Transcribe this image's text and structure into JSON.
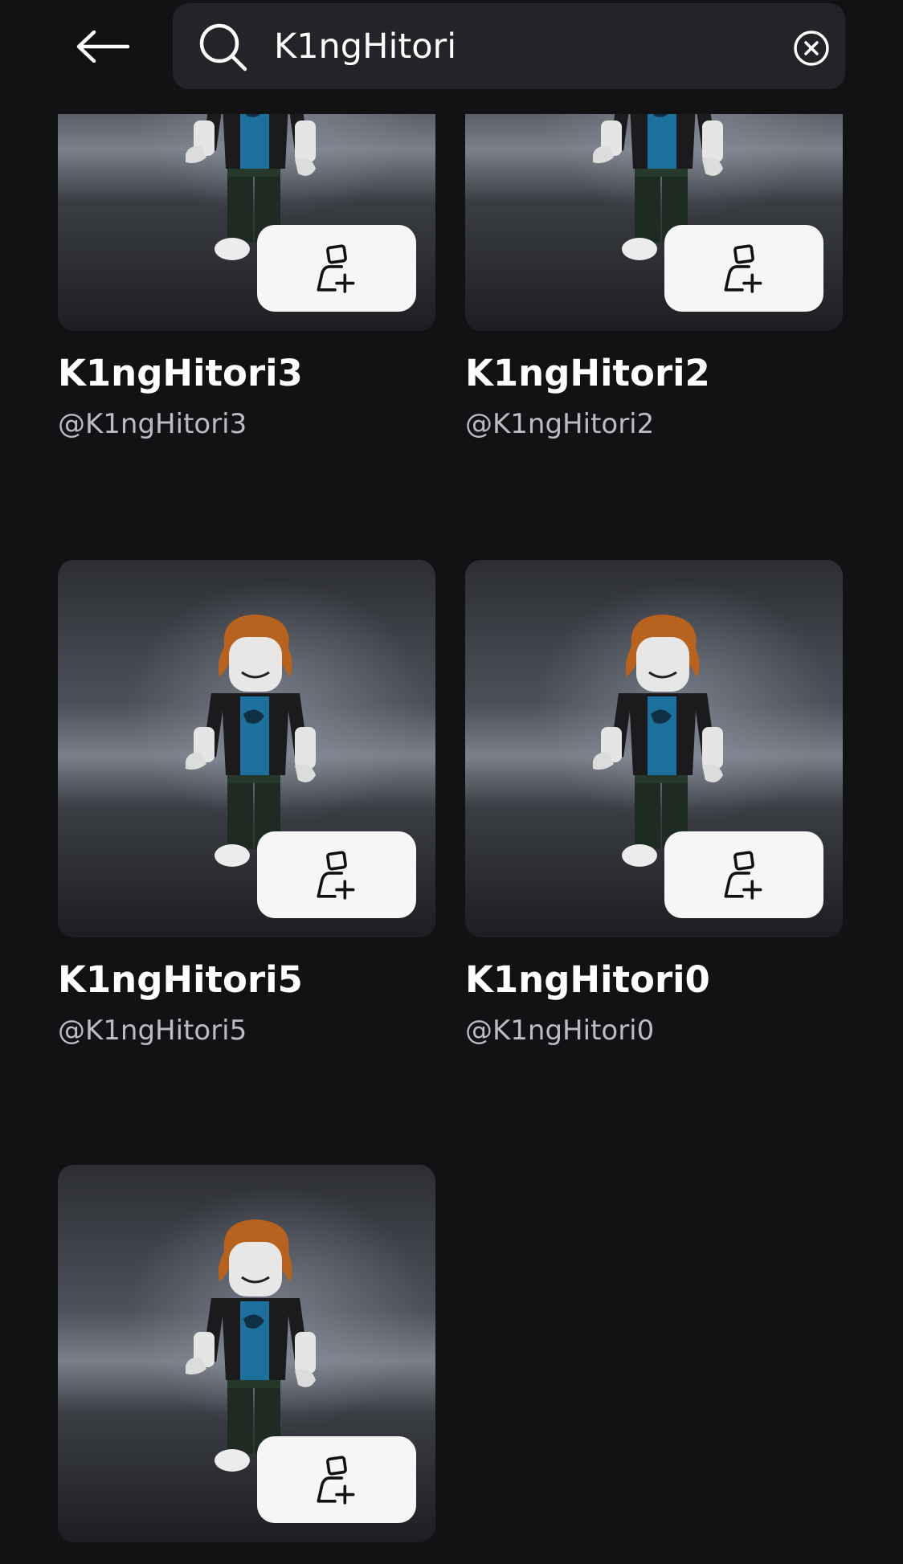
{
  "search": {
    "query": "K1ngHitori"
  },
  "icons": {
    "back": "arrow-left-icon",
    "search": "search-icon",
    "clear": "clear-circle-x-icon",
    "add_friend": "add-friend-icon"
  },
  "results": [
    {
      "display_name": "K1ngHitori3",
      "username": "@K1ngHitori3"
    },
    {
      "display_name": "K1ngHitori2",
      "username": "@K1ngHitori2"
    },
    {
      "display_name": "K1ngHitori5",
      "username": "@K1ngHitori5"
    },
    {
      "display_name": "K1ngHitori0",
      "username": "@K1ngHitori0"
    },
    {
      "display_name": "",
      "username": ""
    }
  ],
  "colors": {
    "background": "#121215",
    "search_bar": "#232428",
    "button": "#f6f6f7"
  }
}
